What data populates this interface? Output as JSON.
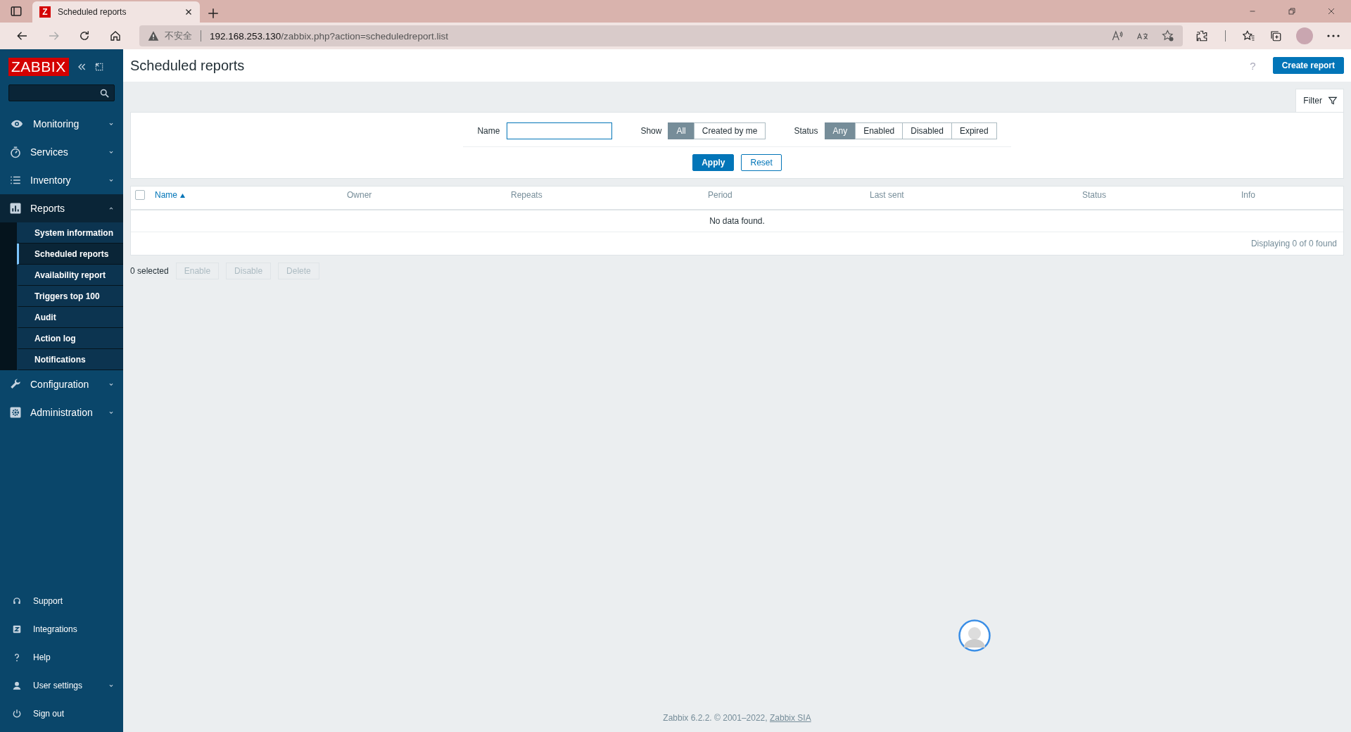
{
  "browser": {
    "tab_title": "Scheduled reports",
    "tab_favicon": "Z",
    "warning": "不安全",
    "url_host": "192.168.253.130",
    "url_path": "/zabbix.php?action=scheduledreport.list"
  },
  "sidebar": {
    "logo": "ZABBIX",
    "menu": [
      {
        "label": "Monitoring",
        "expanded": false
      },
      {
        "label": "Services",
        "expanded": false
      },
      {
        "label": "Inventory",
        "expanded": false
      },
      {
        "label": "Reports",
        "expanded": true,
        "children": [
          {
            "label": "System information",
            "selected": false
          },
          {
            "label": "Scheduled reports",
            "selected": true
          },
          {
            "label": "Availability report",
            "selected": false
          },
          {
            "label": "Triggers top 100",
            "selected": false
          },
          {
            "label": "Audit",
            "selected": false
          },
          {
            "label": "Action log",
            "selected": false
          },
          {
            "label": "Notifications",
            "selected": false
          }
        ]
      },
      {
        "label": "Configuration",
        "expanded": false
      },
      {
        "label": "Administration",
        "expanded": false
      }
    ],
    "bottom": [
      {
        "label": "Support",
        "kind": "link"
      },
      {
        "label": "Integrations",
        "kind": "link"
      },
      {
        "label": "Help",
        "kind": "link"
      },
      {
        "label": "User settings",
        "kind": "menu"
      },
      {
        "label": "Sign out",
        "kind": "link"
      }
    ]
  },
  "page": {
    "title": "Scheduled reports",
    "help": "?",
    "create_button": "Create report"
  },
  "filter": {
    "tab_label": "Filter",
    "name_label": "Name",
    "show_label": "Show",
    "show_options": [
      {
        "label": "All",
        "selected": true
      },
      {
        "label": "Created by me",
        "selected": false
      }
    ],
    "status_label": "Status",
    "status_options": [
      {
        "label": "Any",
        "selected": true
      },
      {
        "label": "Enabled",
        "selected": false
      },
      {
        "label": "Disabled",
        "selected": false
      },
      {
        "label": "Expired",
        "selected": false
      }
    ],
    "apply": "Apply",
    "reset": "Reset"
  },
  "table": {
    "select_all_checked": false,
    "columns": [
      {
        "label": "Name",
        "sorted": true
      },
      {
        "label": "Owner",
        "sorted": false
      },
      {
        "label": "Repeats",
        "sorted": false
      },
      {
        "label": "Period",
        "sorted": false
      },
      {
        "label": "Last sent",
        "sorted": false
      },
      {
        "label": "Status",
        "sorted": false
      },
      {
        "label": "Info",
        "sorted": false
      }
    ],
    "empty_message": "No data found.",
    "summary": "Displaying 0 of 0 found"
  },
  "actions": {
    "selected_count": "0 selected",
    "buttons": [
      {
        "label": "Enable",
        "disabled": true
      },
      {
        "label": "Disable",
        "disabled": true
      },
      {
        "label": "Delete",
        "disabled": true
      }
    ]
  },
  "footer": {
    "text": "Zabbix 6.2.2. © 2001–2022, ",
    "link": "Zabbix SIA"
  }
}
